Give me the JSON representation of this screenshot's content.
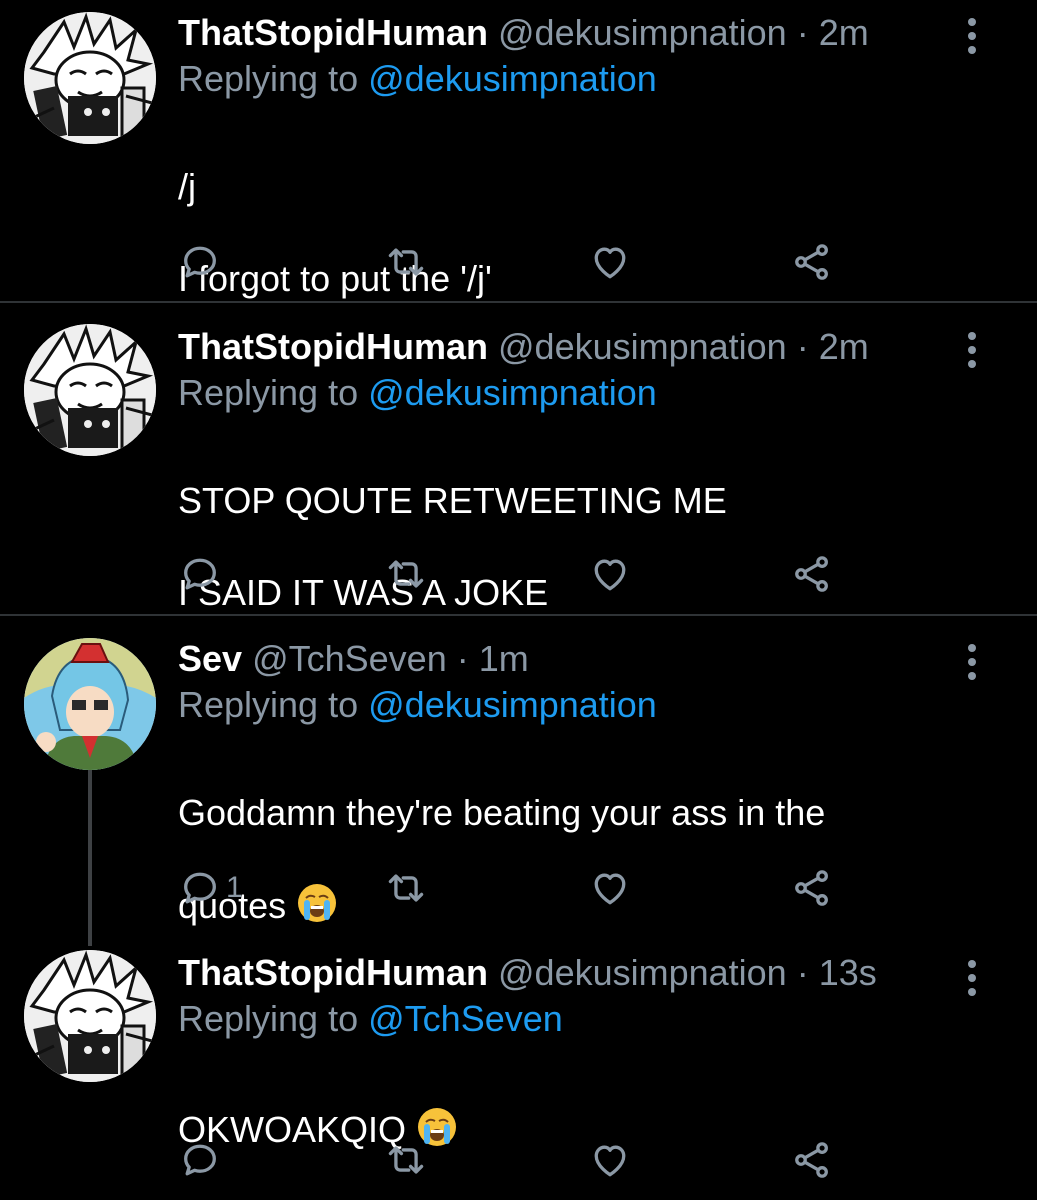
{
  "colors": {
    "background": "#000000",
    "mention": "#1d9bf0",
    "muted": "#8b98a5",
    "divider": "#2f3336"
  },
  "tweets": [
    {
      "name": "ThatStopidHuman",
      "handle": "@dekusimpnation",
      "separator": "·",
      "time": "2m",
      "replying_prefix": "Replying to",
      "replying_to": "@dekusimpnation",
      "body_lines": [
        "/j",
        "I forgot to put the '/j'"
      ],
      "avatar": "manga-character-avatar",
      "reply_count": "",
      "icons": [
        "reply-icon",
        "retweet-icon",
        "like-icon",
        "share-icon"
      ]
    },
    {
      "name": "ThatStopidHuman",
      "handle": "@dekusimpnation",
      "separator": "·",
      "time": "2m",
      "replying_prefix": "Replying to",
      "replying_to": "@dekusimpnation",
      "body_lines": [
        "STOP QOUTE RETWEETING ME",
        "I SAID IT WAS A JOKE"
      ],
      "avatar": "manga-character-avatar",
      "reply_count": ""
    },
    {
      "name": "Sev",
      "handle": "@TchSeven",
      "separator": "·",
      "time": "1m",
      "replying_prefix": "Replying to",
      "replying_to": "@dekusimpnation",
      "body_lines": [
        "Goddamn they're beating your ass in the",
        "quotes"
      ],
      "body_emoji": "loudly-crying-face-emoji",
      "avatar": "anime-character-avatar",
      "reply_count": "1"
    },
    {
      "name": "ThatStopidHuman",
      "handle": "@dekusimpnation",
      "separator": "·",
      "time": "13s",
      "replying_prefix": "Replying to",
      "replying_to": "@TchSeven",
      "body_lines": [
        "OKWOAKQIQ"
      ],
      "body_emoji": "loudly-crying-face-emoji",
      "avatar": "manga-character-avatar",
      "reply_count": ""
    }
  ]
}
